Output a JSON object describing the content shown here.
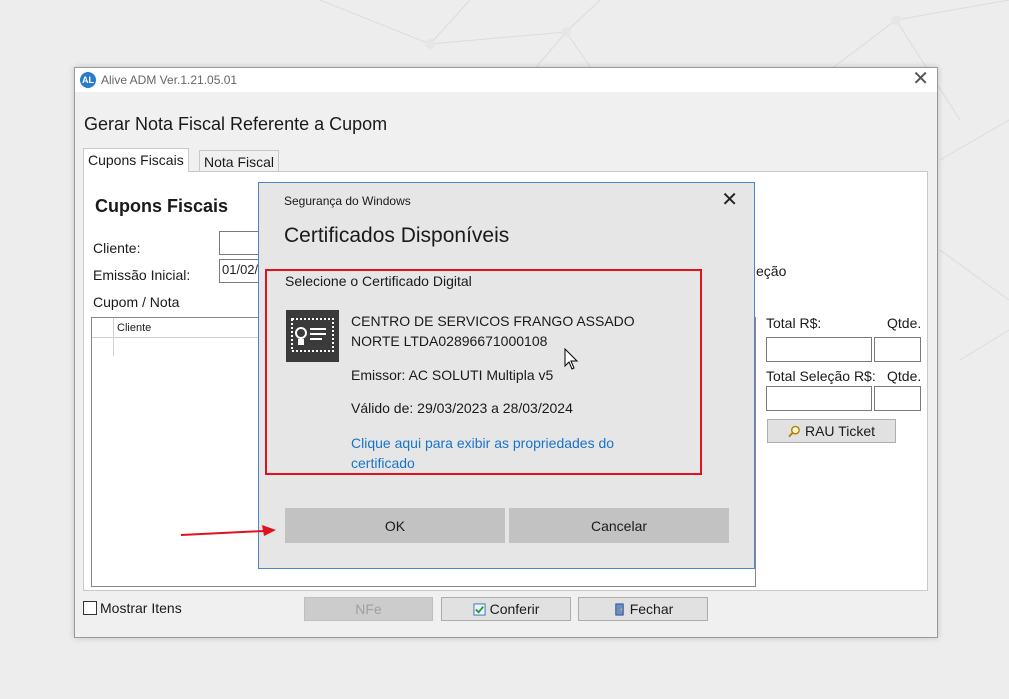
{
  "app": {
    "title": "Alive ADM Ver.1.21.05.01",
    "logo_text": "AL",
    "close_glyph": "✕",
    "page_title": "Gerar Nota Fiscal Referente a Cupom"
  },
  "tabs": [
    {
      "label": "Cupons Fiscais",
      "selected": true
    },
    {
      "label": "Nota Fiscal",
      "selected": false
    }
  ],
  "panel": {
    "heading": "Cupons Fiscais",
    "cliente_label": "Cliente:",
    "cliente_value": "",
    "emissao_label": "Emissão Inicial:",
    "emissao_value": "01/02/",
    "cupom_nota_label": "Cupom / Nota",
    "grid_column": "Cliente",
    "selecao_label_fragment": "eção",
    "total_label": "Total R$:",
    "qtde_label": "Qtde.",
    "total_selecao_label": "Total Seleção R$:",
    "qtde2_label": "Qtde.",
    "rau_button": "RAU Ticket"
  },
  "footer": {
    "mostrar_itens": "Mostrar Itens",
    "nfe_button": "NFe",
    "conferir_button": "Conferir",
    "fechar_button": "Fechar"
  },
  "dialog": {
    "caption": "Segurança do Windows",
    "title": "Certificados Disponíveis",
    "subtitle": "Selecione o Certificado Digital",
    "cert_name_line1": "CENTRO DE SERVICOS FRANGO ASSADO",
    "cert_name_line2": "NORTE LTDA02896671000108",
    "issuer": "Emissor: AC SOLUTI Multipla v5",
    "validity": "Válido de: 29/03/2023 a 28/03/2024",
    "properties_link": "Clique aqui para exibir as propriedades do certificado",
    "ok_button": "OK",
    "cancel_button": "Cancelar",
    "close_glyph": "✕"
  },
  "colors": {
    "highlight": "#e0121c",
    "link": "#1a73c8",
    "dialog_border": "#4a86c8"
  },
  "icons": [
    "app-logo-icon",
    "close-icon",
    "certificate-icon",
    "magnifier-icon",
    "check-icon",
    "door-icon",
    "mouse-cursor-icon",
    "red-arrow-icon"
  ]
}
